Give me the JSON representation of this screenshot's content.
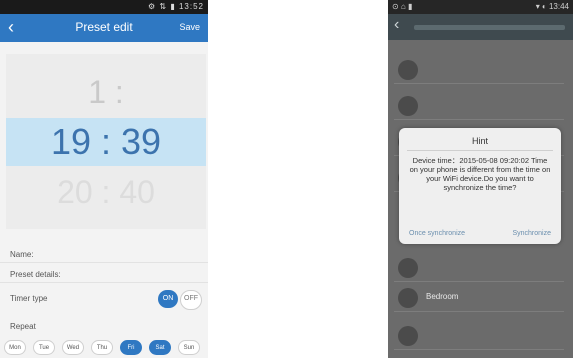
{
  "left": {
    "status": {
      "icons": "⚙ ⇅ ▮ 13:52"
    },
    "header": {
      "back": "‹",
      "title": "Preset edit",
      "save": "Save"
    },
    "picker": {
      "top": "1 :",
      "selected": "19 : 39",
      "bottom": "20 : 40"
    },
    "form": {
      "name_label": "Name:",
      "name_value": "",
      "preset_label": "Preset details:",
      "preset_value": "",
      "timer_label": "Timer type",
      "timer_on": "ON",
      "timer_off": "OFF",
      "repeat_label": "Repeat"
    },
    "days": [
      {
        "label": "Mon",
        "active": false
      },
      {
        "label": "Tue",
        "active": false
      },
      {
        "label": "Wed",
        "active": false
      },
      {
        "label": "Thu",
        "active": false
      },
      {
        "label": "Fri",
        "active": true
      },
      {
        "label": "Sat",
        "active": true
      },
      {
        "label": "Sun",
        "active": false
      }
    ]
  },
  "right": {
    "status": {
      "left": "⊙ ⌂ ▮",
      "right": "▾ ◐ 13:44"
    },
    "header": {
      "back": "‹"
    },
    "devices": [
      "",
      "",
      "",
      "",
      "",
      "Bedroom",
      ""
    ],
    "dialog": {
      "title": "Hint",
      "message": "Device time：2015-05-08 09:20:02 Time on your phone is different from the time on your WiFi device.Do you want to synchronize the time?",
      "left_button": "Once synchronize",
      "right_button": "Synchronize"
    }
  }
}
